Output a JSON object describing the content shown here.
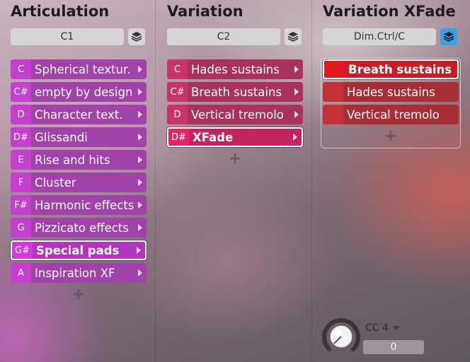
{
  "articulation": {
    "title": "Articulation",
    "slot": "C1",
    "items": [
      {
        "key": "C",
        "label": "Spherical textur."
      },
      {
        "key": "C#",
        "label": "empty by design"
      },
      {
        "key": "D",
        "label": "Character text."
      },
      {
        "key": "D#",
        "label": "Glissandi"
      },
      {
        "key": "E",
        "label": "Rise and hits"
      },
      {
        "key": "F",
        "label": "Cluster"
      },
      {
        "key": "F#",
        "label": "Harmonic effects"
      },
      {
        "key": "G",
        "label": "Pizzicato effects"
      },
      {
        "key": "G#",
        "label": "Special pads"
      },
      {
        "key": "A",
        "label": "Inspiration XF"
      }
    ],
    "selected_index": 8,
    "add_glyph": "+"
  },
  "variation": {
    "title": "Variation",
    "slot": "C2",
    "items": [
      {
        "key": "C",
        "label": "Hades sustains"
      },
      {
        "key": "C#",
        "label": "Breath sustains"
      },
      {
        "key": "D",
        "label": "Vertical tremolo"
      },
      {
        "key": "D#",
        "label": "XFade"
      }
    ],
    "selected_index": 3,
    "add_glyph": "+"
  },
  "xfade": {
    "title": "Variation XFade",
    "slot": "Dim.Ctrl/C",
    "items": [
      {
        "key": "",
        "label": "Breath sustains"
      },
      {
        "key": "",
        "label": "Hades sustains"
      },
      {
        "key": "",
        "label": "Vertical tremolo"
      }
    ],
    "selected_index": 0,
    "add_glyph": "+",
    "controller": {
      "label": "CC 4",
      "value": "0"
    }
  },
  "icons": {
    "layers": "layers-icon",
    "arrow": "chevron-right-icon",
    "knob": "knob-icon",
    "dropdown": "chevron-down-icon"
  },
  "colors": {
    "articulation_accent": "#c43fcf",
    "variation_accent": "#c8336b",
    "xfade_accent": "#e01a1e",
    "layers_active": "#3aa0e6"
  }
}
